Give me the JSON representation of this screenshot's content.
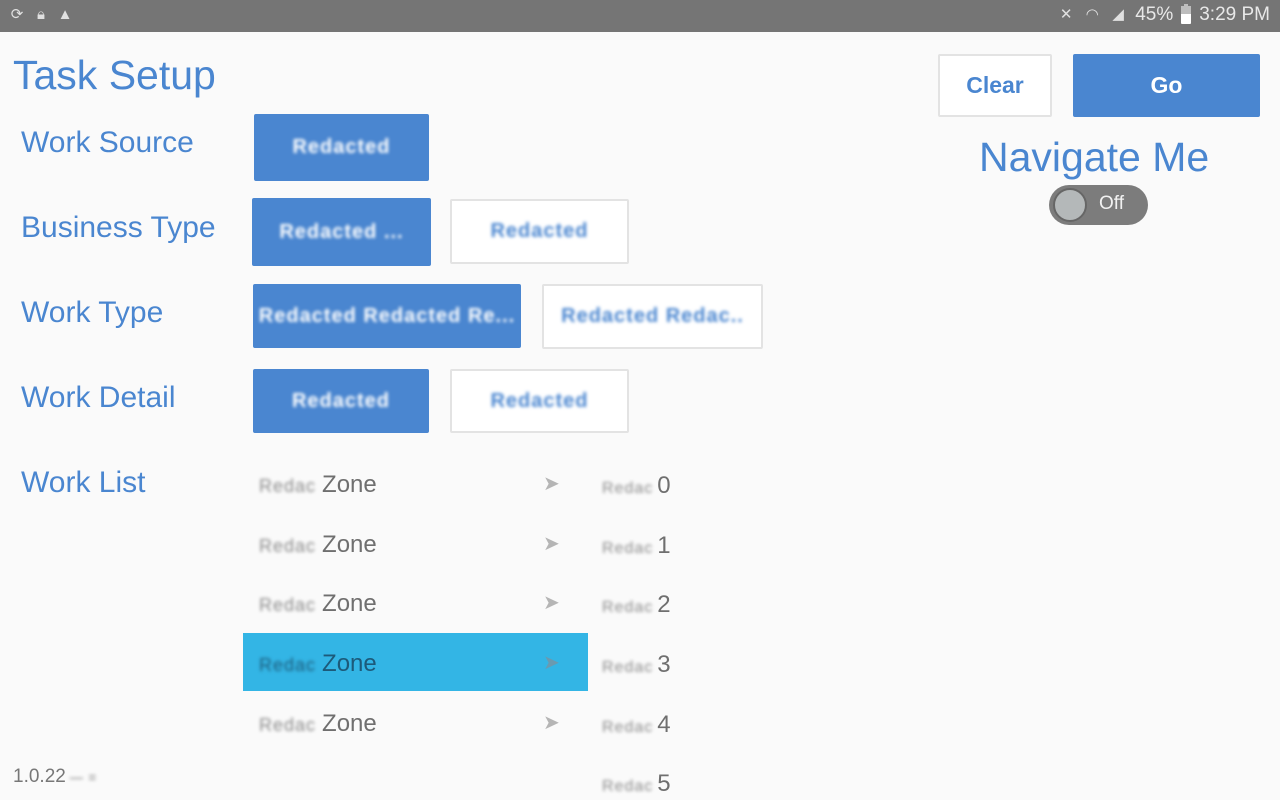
{
  "status_bar": {
    "left_icons": [
      "sync-icon",
      "lock-icon",
      "warning-icon"
    ],
    "right_icons": [
      "vibrate-mute-icon",
      "wifi-icon",
      "signal-icon"
    ],
    "battery": "45%",
    "time": "3:29 PM"
  },
  "page": {
    "title": "Task Setup"
  },
  "sections": {
    "work_source": {
      "label": "Work Source",
      "options": [
        {
          "label": "Redacted",
          "selected": true
        }
      ]
    },
    "business_type": {
      "label": "Business Type",
      "options": [
        {
          "label": "Redacted ...",
          "selected": true
        },
        {
          "label": "Redacted",
          "selected": false
        }
      ]
    },
    "work_type": {
      "label": "Work Type",
      "options": [
        {
          "label": "Redacted Redacted Re...",
          "selected": true
        },
        {
          "label": "Redacted Redac..",
          "selected": false
        }
      ]
    },
    "work_detail": {
      "label": "Work Detail",
      "options": [
        {
          "label": "Redacted",
          "selected": true
        },
        {
          "label": "Redacted",
          "selected": false
        }
      ]
    },
    "work_list": {
      "label": "Work List",
      "items": [
        {
          "prefix": "Redac",
          "name": "Zone",
          "selected": false
        },
        {
          "prefix": "Redac",
          "name": "Zone",
          "selected": false
        },
        {
          "prefix": "Redac",
          "name": "Zone",
          "selected": false
        },
        {
          "prefix": "Redac",
          "name": "Zone",
          "selected": true
        },
        {
          "prefix": "Redac",
          "name": "Zone",
          "selected": false
        }
      ],
      "numbers": [
        {
          "prefix": "Redac",
          "value": "0"
        },
        {
          "prefix": "Redac",
          "value": "1"
        },
        {
          "prefix": "Redac",
          "value": "2"
        },
        {
          "prefix": "Redac",
          "value": "3"
        },
        {
          "prefix": "Redac",
          "value": "4"
        },
        {
          "prefix": "Redac",
          "value": "5"
        }
      ],
      "arrow_glyph": "➤"
    }
  },
  "actions": {
    "clear_label": "Clear",
    "go_label": "Go"
  },
  "navigate": {
    "label": "Navigate Me",
    "toggle_state": "Off"
  },
  "footer": {
    "version": "1.0.22",
    "version_suffix": "— ="
  },
  "colors": {
    "accent": "#4a86d0",
    "selected_row": "#33b5e5",
    "status_bar": "#757575"
  }
}
